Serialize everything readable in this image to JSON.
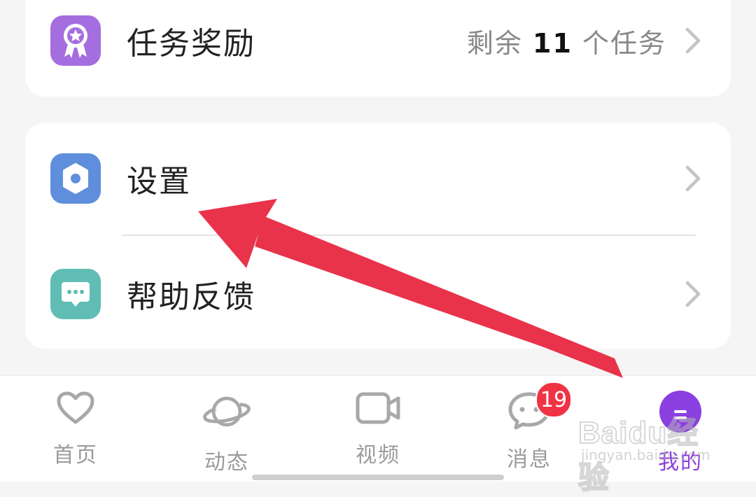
{
  "menu": {
    "task_reward": {
      "label": "任务奖励",
      "status_prefix": "剩余 ",
      "status_count": "11",
      "status_suffix": " 个任务",
      "icon": "ribbon-star-icon",
      "icon_color": "#a46ee0"
    },
    "settings": {
      "label": "设置",
      "icon": "gear-icon",
      "icon_color": "#5f8fdc"
    },
    "help_feedback": {
      "label": "帮助反馈",
      "icon": "chat-bubble-icon",
      "icon_color": "#5fbdb5"
    }
  },
  "tabs": [
    {
      "label": "首页",
      "icon": "heart-icon",
      "active": false
    },
    {
      "label": "动态",
      "icon": "planet-icon",
      "active": false
    },
    {
      "label": "视频",
      "icon": "video-camera-icon",
      "active": false
    },
    {
      "label": "消息",
      "icon": "chat-face-icon",
      "active": false,
      "badge": "19"
    },
    {
      "label": "我的",
      "icon": "profile-avatar-icon",
      "active": true
    }
  ],
  "colors": {
    "accent": "#8a3fe0",
    "badge": "#f03344",
    "arrow": "#e8334a"
  },
  "watermark": {
    "main": "Baidu经验",
    "sub": "jingyan.baidu.com"
  }
}
